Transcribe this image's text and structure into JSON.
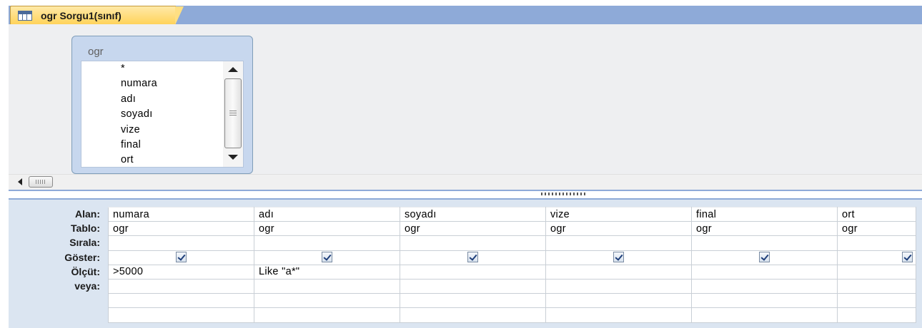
{
  "tab": {
    "title": "ogr Sorgu1(sınıf)",
    "icon": "query-design-icon"
  },
  "table_box": {
    "name": "ogr",
    "fields": [
      "*",
      "numara",
      "adı",
      "soyadı",
      "vize",
      "final",
      "ort"
    ]
  },
  "grid": {
    "row_labels": [
      "Alan:",
      "Tablo:",
      "Sırala:",
      "Göster:",
      "Ölçüt:",
      "veya:"
    ],
    "columns": [
      {
        "field": "numara",
        "table": "ogr",
        "sort": "",
        "show": true,
        "criteria": ">5000",
        "or": ""
      },
      {
        "field": "adı",
        "table": "ogr",
        "sort": "",
        "show": true,
        "criteria": "Like \"a*\"",
        "or": ""
      },
      {
        "field": "soyadı",
        "table": "ogr",
        "sort": "",
        "show": true,
        "criteria": "",
        "or": ""
      },
      {
        "field": "vize",
        "table": "ogr",
        "sort": "",
        "show": true,
        "criteria": "",
        "or": ""
      },
      {
        "field": "final",
        "table": "ogr",
        "sort": "",
        "show": true,
        "criteria": "",
        "or": ""
      },
      {
        "field": "ort",
        "table": "ogr",
        "sort": "",
        "show": true,
        "criteria": "",
        "or": ""
      }
    ]
  }
}
